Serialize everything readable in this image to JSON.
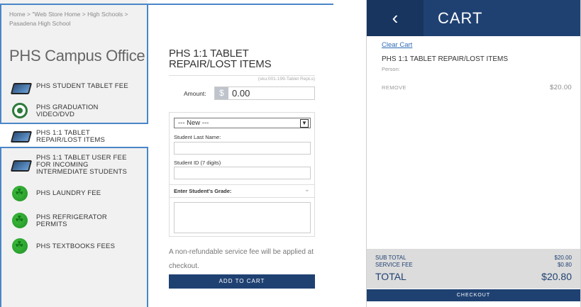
{
  "store": {
    "breadcrumb": "Home > \"Web Store Home > High Schools > Pasadena High School",
    "title": "PHS Campus Office",
    "items": [
      {
        "label": "PHS STUDENT TABLET FEE",
        "icon": "tablet-icon"
      },
      {
        "label": "PHS GRADUATION VIDEO/DVD",
        "icon": "school-seal-icon"
      },
      {
        "label": "PHS 1:1 TABLET REPAIR/LOST ITEMS",
        "icon": "tablet-icon"
      },
      {
        "label": "PHS 1:1 TABLET USER FEE FOR INCOMING INTERMEDIATE STUDENTS",
        "icon": "tablet-icon"
      },
      {
        "label": "PHS LAUNDRY FEE",
        "icon": "leaf-icon"
      },
      {
        "label": "PHS REFRIGERATOR PERMITS",
        "icon": "leaf-icon"
      },
      {
        "label": "PHS TEXTBOOKS FEES",
        "icon": "leaf-icon"
      }
    ]
  },
  "product": {
    "title": "PHS 1:1 TABLET REPAIR/LOST ITEMS",
    "sku": "(sku:001-199-Tablet RepLs)",
    "amount_label": "Amount:",
    "currency_symbol": "$",
    "amount_value": "0.00",
    "select_value": "--- New ---",
    "last_name_label": "Student Last Name:",
    "student_id_label": "Student ID (7 digits)",
    "grade_label": "Enter Student's Grade:",
    "fee_note": "A non-refundable service fee will be applied at checkout.",
    "add_button": "ADD TO CART"
  },
  "cart": {
    "title": "CART",
    "back_icon": "chevron-left-icon",
    "clear_label": "Clear Cart",
    "item_name": "PHS 1:1 TABLET REPAIR/LOST ITEMS",
    "item_sub": "Person:",
    "remove_label": "REMOVE",
    "item_price": "$20.00",
    "subtotal_label": "SUB TOTAL",
    "subtotal_value": "$20.00",
    "service_fee_label": "SERVICE FEE",
    "service_fee_value": "$0.80",
    "total_label": "TOTAL",
    "total_value": "$20.80",
    "checkout_label": "CHECKOUT"
  },
  "colors": {
    "brand_navy": "#1f4172",
    "link_blue": "#2e6bb5",
    "frame_blue": "#4a86c8"
  }
}
